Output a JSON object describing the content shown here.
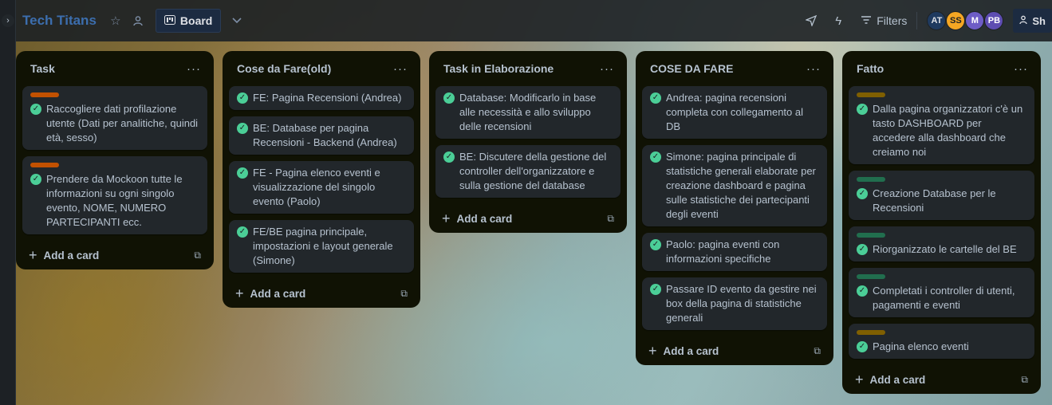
{
  "header": {
    "title": "Tech Titans",
    "view_label": "Board",
    "filters_label": "Filters",
    "share_label": "Sh",
    "avatars": [
      {
        "initials": "AT",
        "bg": "#1f3a5f",
        "fg": "#dfe1e6"
      },
      {
        "initials": "SS",
        "bg": "#f5a623",
        "fg": "#1d2125"
      },
      {
        "initials": "M",
        "bg": "#6e5dc6",
        "fg": "#ffffff"
      },
      {
        "initials": "PB",
        "bg": "#5e4db2",
        "fg": "#ffffff"
      }
    ]
  },
  "colors": {
    "label_orange": "#c25100",
    "label_green": "#216e4e",
    "label_yellow": "#7f5f01",
    "check": "#4bce97"
  },
  "lists": [
    {
      "title": "Task",
      "add_label": "Add a card",
      "cards": [
        {
          "label": "orange",
          "text": "Raccogliere dati profilazione utente (Dati per analitiche, quindi età, sesso)"
        },
        {
          "label": "orange",
          "text": "Prendere da Mockoon tutte le informazioni su ogni singolo evento, NOME, NUMERO PARTECIPANTI ecc."
        }
      ]
    },
    {
      "title": "Cose da Fare(old)",
      "add_label": "Add a card",
      "cards": [
        {
          "label": "",
          "text": "FE: Pagina Recensioni (Andrea)"
        },
        {
          "label": "",
          "text": "BE: Database per pagina Recensioni - Backend (Andrea)"
        },
        {
          "label": "",
          "text": "FE - Pagina elenco eventi e visualizzazione del singolo evento (Paolo)"
        },
        {
          "label": "",
          "text": "FE/BE pagina principale, impostazioni e layout generale (Simone)"
        }
      ]
    },
    {
      "title": "Task in Elaborazione",
      "add_label": "Add a card",
      "cards": [
        {
          "label": "",
          "text": "Database: Modificarlo in base alle necessità e allo sviluppo delle recensioni"
        },
        {
          "label": "",
          "text": "BE: Discutere della gestione del controller dell'organizzatore e sulla gestione del database"
        }
      ]
    },
    {
      "title": "COSE DA FARE",
      "add_label": "Add a card",
      "cards": [
        {
          "label": "",
          "text": "Andrea: pagina recensioni completa con collegamento al DB"
        },
        {
          "label": "",
          "text": "Simone: pagina principale di statistiche generali elaborate per creazione dashboard e pagina sulle statistiche dei partecipanti degli eventi"
        },
        {
          "label": "",
          "text": "Paolo: pagina eventi con informazioni specifiche"
        },
        {
          "label": "",
          "text": "Passare ID evento da gestire nei box della pagina di statistiche generali"
        }
      ]
    },
    {
      "title": "Fatto",
      "add_label": "Add a card",
      "cards": [
        {
          "label": "yellow",
          "text": "Dalla pagina organizzatori c'è un tasto DASHBOARD per accedere alla dashboard che creiamo noi"
        },
        {
          "label": "green",
          "text": "Creazione Database per le Recensioni"
        },
        {
          "label": "green",
          "text": "Riorganizzato le cartelle del BE"
        },
        {
          "label": "green",
          "text": "Completati i controller di utenti, pagamenti e eventi"
        },
        {
          "label": "yellow",
          "text": "Pagina elenco eventi"
        }
      ]
    }
  ]
}
